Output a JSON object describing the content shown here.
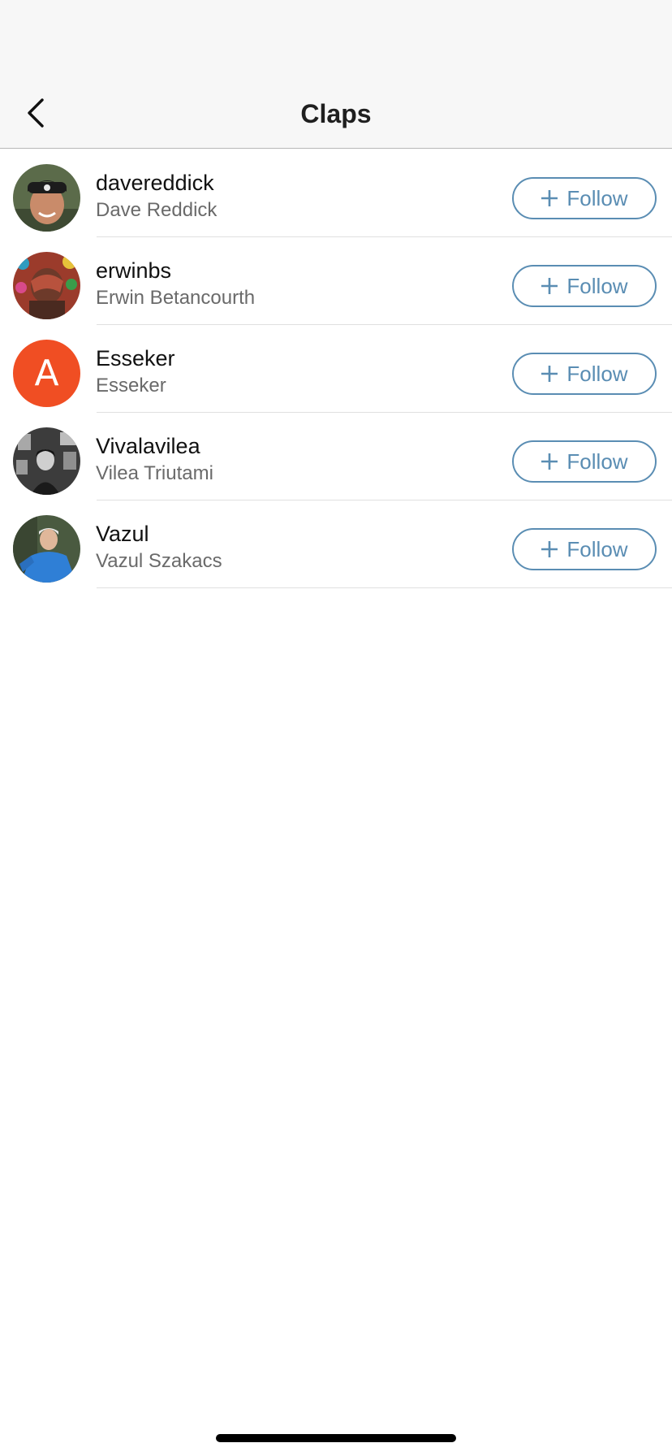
{
  "nav": {
    "title": "Claps",
    "back_icon": "chevron-left-icon"
  },
  "users": [
    {
      "username": "davereddick",
      "full_name": "Dave Reddick",
      "follow_label": "Follow",
      "avatar": {
        "type": "photo",
        "bg": "#5b6b4a",
        "accent": "#c98b6a"
      }
    },
    {
      "username": "erwinbs",
      "full_name": "Erwin Betancourth",
      "follow_label": "Follow",
      "avatar": {
        "type": "photo",
        "bg": "#b8523d",
        "accent": "#6d3a2a"
      }
    },
    {
      "username": "Esseker",
      "full_name": "Esseker",
      "follow_label": "Follow",
      "avatar": {
        "type": "letter",
        "letter": "A",
        "bg": "#f04e23"
      }
    },
    {
      "username": "Vivalavilea",
      "full_name": "Vilea Triutami",
      "follow_label": "Follow",
      "avatar": {
        "type": "photo",
        "bg": "#3c3c3c",
        "accent": "#cfcfcf"
      }
    },
    {
      "username": "Vazul",
      "full_name": "Vazul Szakacs",
      "follow_label": "Follow",
      "avatar": {
        "type": "photo",
        "bg": "#4a5a40",
        "accent": "#2f7fd6"
      }
    }
  ],
  "colors": {
    "accent": "#5a8db3",
    "letter_avatar": "#f04e23",
    "nav_background": "#f7f7f7"
  },
  "icons": {
    "follow": "plus-icon",
    "back": "chevron-left-icon"
  }
}
